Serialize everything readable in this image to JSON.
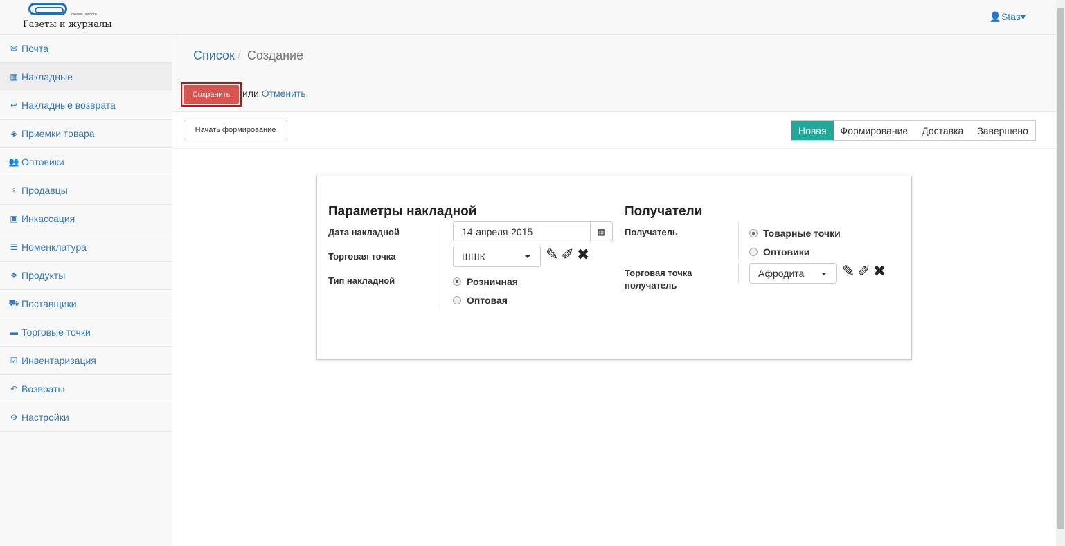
{
  "header": {
    "logo_text": "Газеты и журналы",
    "logo_small": "свежие новости",
    "user": "Stas"
  },
  "sidebar": {
    "items": [
      {
        "icon": "envelope-icon",
        "glyph": "✉",
        "label": "Почта"
      },
      {
        "icon": "table-icon",
        "glyph": "▦",
        "label": "Накладные"
      },
      {
        "icon": "reply-icon",
        "glyph": "↩",
        "label": "Накладные возврата"
      },
      {
        "icon": "cube-icon",
        "glyph": "◈",
        "label": "Приемки товара"
      },
      {
        "icon": "users-icon",
        "glyph": "👥",
        "label": "Оптовики"
      },
      {
        "icon": "female-icon",
        "glyph": "♀",
        "label": "Продавцы"
      },
      {
        "icon": "money-icon",
        "glyph": "▣",
        "label": "Инкассация"
      },
      {
        "icon": "bars-icon",
        "glyph": "☰",
        "label": "Номенклатура"
      },
      {
        "icon": "cubes-icon",
        "glyph": "❖",
        "label": "Продукты"
      },
      {
        "icon": "truck-icon",
        "glyph": "⛟",
        "label": "Поставщики"
      },
      {
        "icon": "archive-icon",
        "glyph": "▬",
        "label": "Торговые точки"
      },
      {
        "icon": "check-square-icon",
        "glyph": "☑",
        "label": "Инвентаризация"
      },
      {
        "icon": "reply-all-icon",
        "glyph": "↶",
        "label": "Возвраты"
      },
      {
        "icon": "cogs-icon",
        "glyph": "⚙",
        "label": "Настройки"
      }
    ]
  },
  "breadcrumb": {
    "list": "Список",
    "current": "Создание"
  },
  "actions": {
    "save": "Сохранить",
    "or": "или",
    "cancel": "Отменить",
    "start": "Начать формирование"
  },
  "status_tabs": [
    "Новая",
    "Формирование",
    "Доставка",
    "Завершено"
  ],
  "params": {
    "title": "Параметры накладной",
    "date_label": "Дата накладной",
    "date_value": "14-апреля-2015",
    "point_label": "Торговая точка",
    "point_value": "ШШК",
    "type_label": "Тип накладной",
    "type_options": [
      "Розничная",
      "Оптовая"
    ]
  },
  "recipients": {
    "title": "Получатели",
    "recipient_label": "Получатель",
    "recipient_options": [
      "Товарные точки",
      "Оптовики"
    ],
    "point_label": "Торговая точка получатель",
    "point_value": "Афродита"
  },
  "colors": {
    "accent": "#20a89a",
    "danger": "#d9534f",
    "link": "#337ab7"
  }
}
